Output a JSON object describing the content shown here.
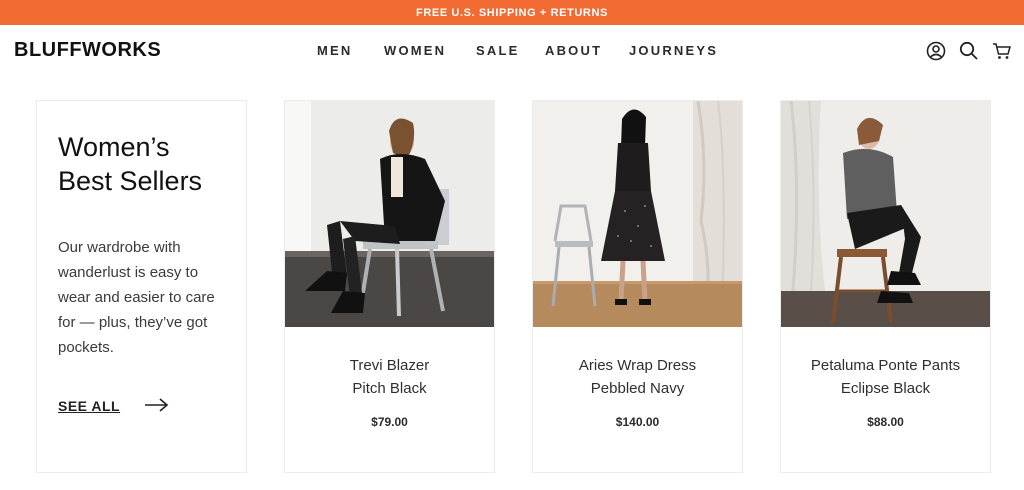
{
  "promo": {
    "text": "FREE U.S. SHIPPING + RETURNS"
  },
  "header": {
    "logo": "BLUFFWORKS",
    "nav": [
      "MEN",
      "WOMEN",
      "SALE",
      "ABOUT",
      "JOURNEYS"
    ],
    "icons": [
      "account-icon",
      "search-icon",
      "cart-icon"
    ]
  },
  "intro": {
    "title_line1": "Women’s",
    "title_line2": "Best Sellers",
    "text": "Our wardrobe with wanderlust is easy to wear and easier to care for  — plus, they’ve got pockets.",
    "cta": "SEE ALL"
  },
  "products": [
    {
      "name": "Trevi Blazer",
      "color": "Pitch Black",
      "price": "$79.00"
    },
    {
      "name": "Aries Wrap Dress",
      "color": "Pebbled Navy",
      "price": "$140.00"
    },
    {
      "name": "Petaluma Ponte Pants",
      "color": "Eclipse Black",
      "price": "$88.00"
    }
  ],
  "colors": {
    "promo": "#f26b33",
    "text": "#1a1a1a"
  }
}
